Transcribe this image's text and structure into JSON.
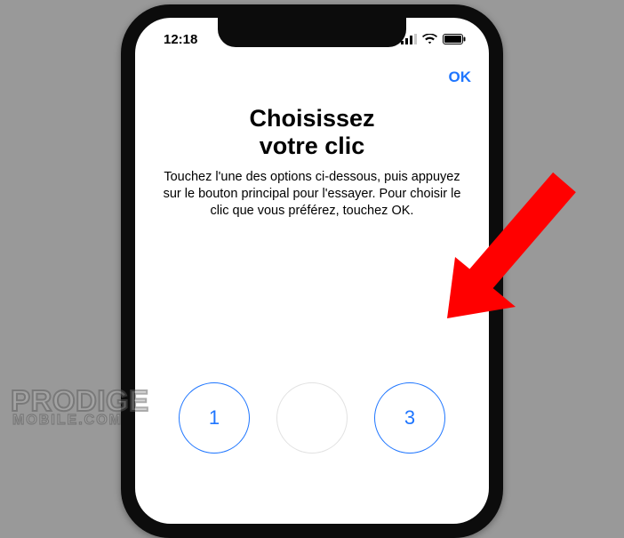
{
  "status": {
    "time": "12:18"
  },
  "nav": {
    "ok": "OK"
  },
  "page": {
    "title_line1": "Choisissez",
    "title_line2": "votre clic",
    "subtitle": "Touchez l'une des options ci-dessous, puis appuyez sur le bouton principal pour l'essayer. Pour choisir le clic que vous préférez, touchez OK."
  },
  "options": {
    "one": "1",
    "two": "",
    "three": "3"
  },
  "watermark": {
    "top": "PRODIGE",
    "bottom": "MOBILE.COM"
  },
  "colors": {
    "accent": "#1f76ff",
    "arrow": "#ff0000"
  }
}
